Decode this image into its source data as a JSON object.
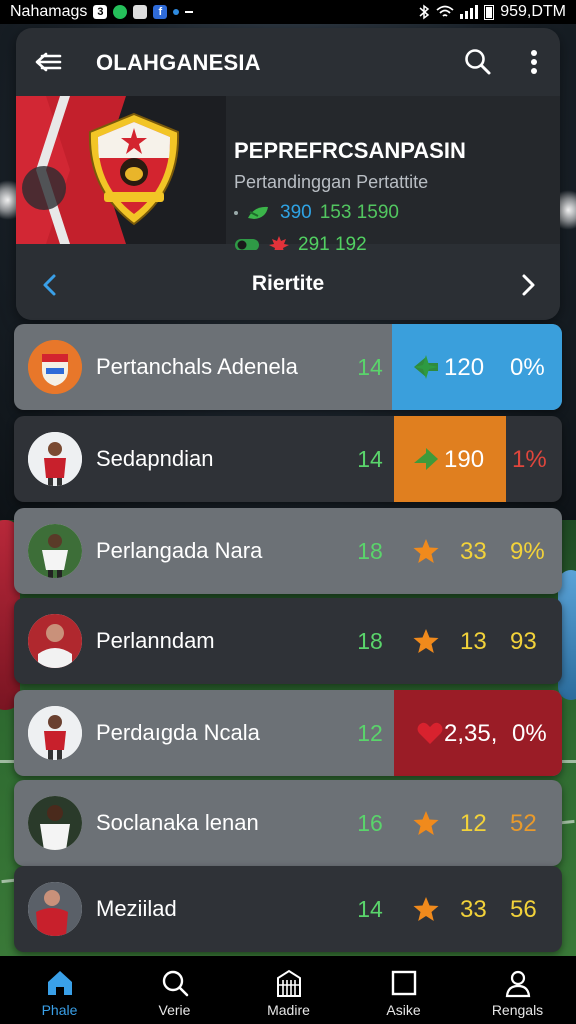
{
  "status_bar": {
    "carrier": "Nahamags",
    "notif_badges": [
      "3"
    ],
    "time": "959,DTM"
  },
  "app_bar": {
    "title": "OLAHGANESIA"
  },
  "team": {
    "name": "PEPREFRCSANPASIN",
    "subtitle": "Pertandinggan Pertattite",
    "stat_a": {
      "v1": "390",
      "v2": "153 1590"
    },
    "stat_b": {
      "v1": "291 192"
    }
  },
  "pager": {
    "label": "Riertite"
  },
  "rows": [
    {
      "name": "Pertanchals Adenela",
      "count": "14",
      "value": "120",
      "percent": "0%"
    },
    {
      "name": "Sedapndian",
      "count": "14",
      "value": "190",
      "percent": "1%"
    },
    {
      "name": "Perlangada Nara",
      "count": "18",
      "value": "33",
      "percent": "9%"
    },
    {
      "name": "Perlanndam",
      "count": "18",
      "value": "13",
      "percent": "93"
    },
    {
      "name": "Perdaıgda Ncala",
      "count": "12",
      "value": "2,35,",
      "percent": "0%"
    },
    {
      "name": "Soclanaka lenan",
      "count": "16",
      "value": "12",
      "percent": "52"
    },
    {
      "name": "Meziilad",
      "count": "14",
      "value": "33",
      "percent": "56"
    }
  ],
  "icons": {
    "row_marks": [
      "green-arrow-icon",
      "green-arrow-icon",
      "star-icon",
      "star-icon",
      "heart-icon",
      "star-icon",
      "star-icon"
    ]
  },
  "colors": {
    "highlight_blue": "#3a9fdc",
    "highlight_orange": "#e07f1f",
    "highlight_red": "#9a1c26",
    "count_green": "#5ad46b",
    "star_orange": "#f08a1c",
    "value_yellow": "#f2d23a",
    "value_orange": "#e89a2c",
    "percent_red": "#e0463c",
    "nav_active": "#3aa0e8"
  },
  "bottom_nav": [
    {
      "label": "Phale",
      "active": true
    },
    {
      "label": "Verie"
    },
    {
      "label": "Madire"
    },
    {
      "label": "Asike"
    },
    {
      "label": "Rengals"
    }
  ]
}
